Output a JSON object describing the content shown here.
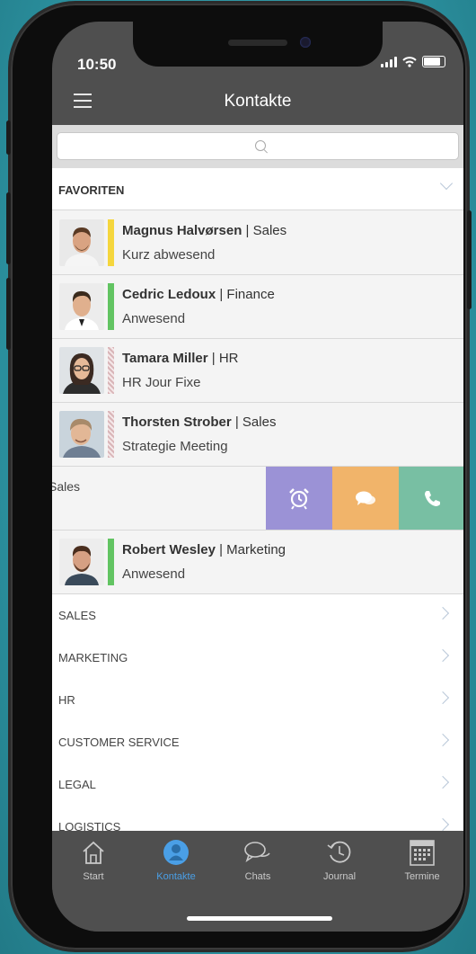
{
  "status_bar": {
    "time": "10:50"
  },
  "nav": {
    "title": "Kontakte"
  },
  "search": {
    "placeholder": ""
  },
  "favorites": {
    "label": "FAVORITEN",
    "contacts": [
      {
        "name": "Magnus Halvørsen",
        "dept": " | Sales",
        "status": "Kurz abwesend",
        "status_color": "#f5d63d"
      },
      {
        "name": "Cedric Ledoux",
        "dept": " | Finance",
        "status": "Anwesend",
        "status_color": "#62c462"
      },
      {
        "name": "Tamara Miller",
        "dept": " | HR",
        "status": "HR Jour Fixe",
        "status_color": "pattern"
      },
      {
        "name": "Thorsten Strober",
        "dept": " | Sales",
        "status": "Strategie Meeting",
        "status_color": "pattern"
      }
    ],
    "swiped_row": {
      "text": "Sales"
    },
    "last_contact": {
      "name": "Robert Wesley",
      "dept": " | Marketing",
      "status": "Anwesend",
      "status_color": "#62c462"
    }
  },
  "actions": {
    "alarm_color": "#9b92d6",
    "chat_color": "#f1b46a",
    "call_color": "#78bfa3"
  },
  "groups": [
    "SALES",
    "MARKETING",
    "HR",
    "CUSTOMER SERVICE",
    "LEGAL",
    "LOGISTICS"
  ],
  "tabs": [
    {
      "label": "Start",
      "icon": "home-icon"
    },
    {
      "label": "Kontakte",
      "icon": "contacts-icon",
      "active": true
    },
    {
      "label": "Chats",
      "icon": "chat-icon"
    },
    {
      "label": "Journal",
      "icon": "history-icon"
    },
    {
      "label": "Termine",
      "icon": "calendar-icon"
    }
  ],
  "colors": {
    "accent": "#4a9fe6",
    "header": "#4f4f4f",
    "background": "#2a8e9c"
  }
}
